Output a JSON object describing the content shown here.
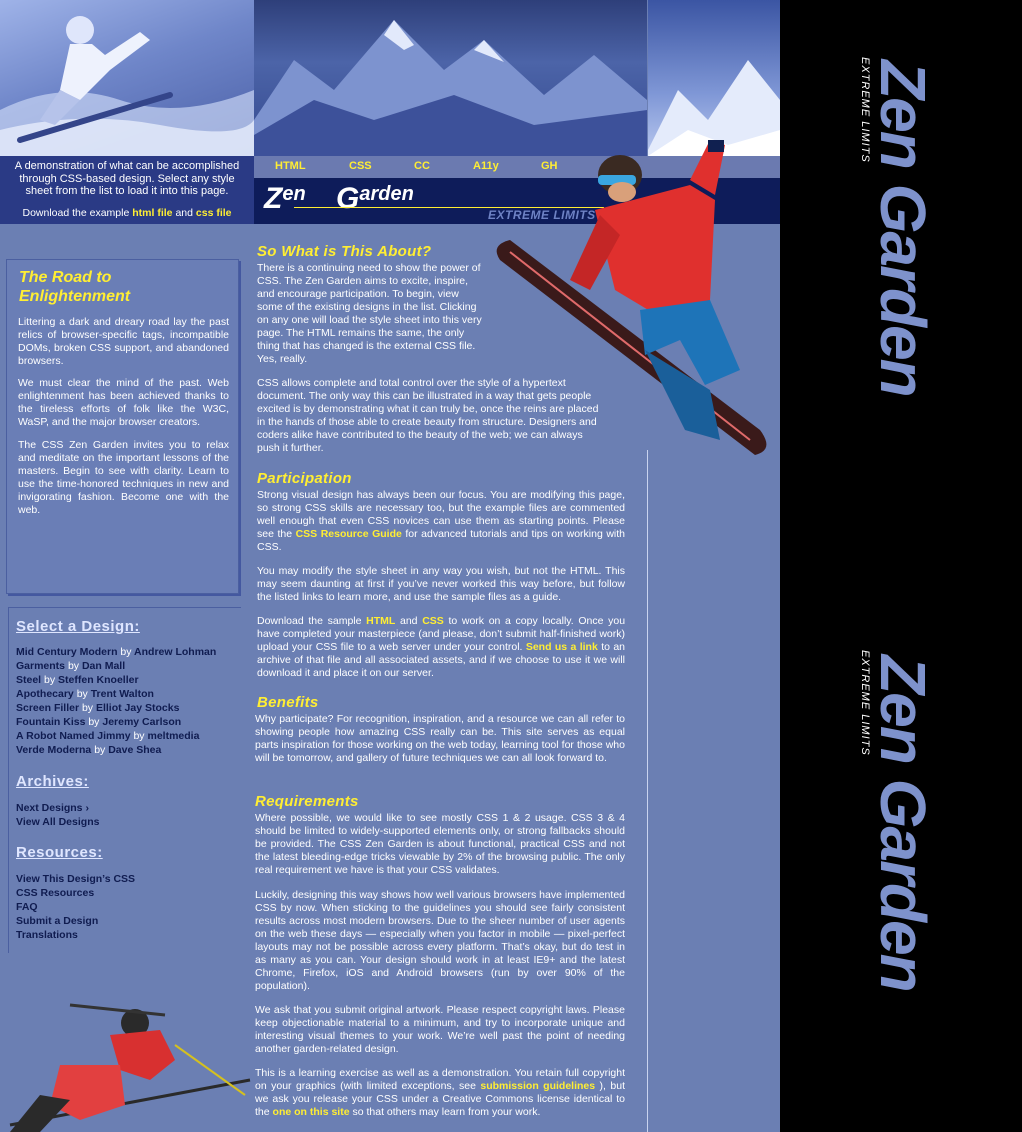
{
  "intro": {
    "text": "A demonstration of what can be accomplished through CSS-based design. Select any style sheet from the list to load it into this page.",
    "download_prefix": "Download the example",
    "html_file": "html file",
    "and": "and",
    "css_file": "css file"
  },
  "nav": {
    "items": [
      "HTML",
      "CSS",
      "CC",
      "A11y",
      "GH"
    ]
  },
  "logo": {
    "zen": "Zen",
    "garden": "Garden",
    "tagline": "EXTREME LIMITS"
  },
  "road": {
    "title": "The Road to Enlightenment",
    "p1": "Littering a dark and dreary road lay the past relics of browser-specific tags, incompatible DOMs, broken CSS support, and abandoned browsers.",
    "p2": "We must clear the mind of the past. Web enlightenment has been achieved thanks to the tireless efforts of folk like the W3C, WaSP, and the major browser creators.",
    "p3": "The CSS Zen Garden invites you to relax and meditate on the important lessons of the masters. Begin to see with clarity. Learn to use the time-honored techniques in new and invigorating fashion. Become one with the web."
  },
  "select": {
    "title": "Select a Design:",
    "by": "by",
    "designs": [
      {
        "name": "Mid Century Modern",
        "author": "Andrew Lohman"
      },
      {
        "name": "Garments",
        "author": "Dan Mall"
      },
      {
        "name": "Steel",
        "author": "Steffen Knoeller"
      },
      {
        "name": "Apothecary",
        "author": "Trent Walton"
      },
      {
        "name": "Screen Filler",
        "author": "Elliot Jay Stocks"
      },
      {
        "name": "Fountain Kiss",
        "author": "Jeremy Carlson"
      },
      {
        "name": "A Robot Named Jimmy",
        "author": "meltmedia"
      },
      {
        "name": "Verde Moderna",
        "author": "Dave Shea"
      }
    ]
  },
  "archives": {
    "title": "Archives:",
    "next": "Next Designs ›",
    "all": "View All Designs"
  },
  "resources": {
    "title": "Resources:",
    "items": [
      "View This Design’s CSS",
      "CSS Resources",
      "FAQ",
      "Submit a Design",
      "Translations"
    ]
  },
  "about": {
    "title": "So What is This About?",
    "p1": "There is a continuing need to show the power of CSS. The Zen Garden aims to excite, inspire, and encourage participation. To begin, view some of the existing designs in the list. Clicking on any one will load the style sheet into this very page. The HTML remains the same, the only thing that has changed is the external CSS file. Yes, really.",
    "p2": "CSS allows complete and total control over the style of a hypertext document. The only way this can be illustrated in a way that gets people excited is by demonstrating what it can truly be, once the reins are placed in the hands of those able to create beauty from structure. Designers and coders alike have contributed to the beauty of the web; we can always push it further."
  },
  "participation": {
    "title": "Participation",
    "p1_a": "Strong visual design has always been our focus. You are modifying this page, so strong CSS skills are necessary too, but the example files are commented well enough that even CSS novices can use them as starting points. Please see the",
    "p1_link": "CSS Resource Guide",
    "p1_b": "for advanced tutorials and tips on working with CSS.",
    "p2": "You may modify the style sheet in any way you wish, but not the HTML. This may seem daunting at first if you’ve never worked this way before, but follow the listed links to learn more, and use the sample files as a guide.",
    "p3_a": "Download the sample",
    "p3_html": "HTML",
    "p3_and": "and",
    "p3_css": "CSS",
    "p3_b": "to work on a copy locally. Once you have completed your masterpiece (and please, don’t submit half-finished work) upload your CSS file to a web server under your control.",
    "p3_link": "Send us a link",
    "p3_c": "to an archive of that file and all associated assets, and if we choose to use it we will download it and place it on our server."
  },
  "benefits": {
    "title": "Benefits",
    "p1": "Why participate? For recognition, inspiration, and a resource we can all refer to showing people how amazing CSS really can be. This site serves as equal parts inspiration for those working on the web today, learning tool for those who will be tomorrow, and gallery of future techniques we can all look forward to."
  },
  "requirements": {
    "title": "Requirements",
    "p1": "Where possible, we would like to see mostly CSS 1 & 2 usage. CSS 3 & 4 should be limited to widely-supported elements only, or strong fallbacks should be provided. The CSS Zen Garden is about functional, practical CSS and not the latest bleeding-edge tricks viewable by 2% of the browsing public. The only real requirement we have is that your CSS validates.",
    "p2": "Luckily, designing this way shows how well various browsers have implemented CSS by now. When sticking to the guidelines you should see fairly consistent results across most modern browsers. Due to the sheer number of user agents on the web these days — especially when you factor in mobile — pixel-perfect layouts may not be possible across every platform. That’s okay, but do test in as many as you can. Your design should work in at least IE9+ and the latest Chrome, Firefox, iOS and Android browsers (run by over 90% of the population).",
    "p3": "We ask that you submit original artwork. Please respect copyright laws. Please keep objectionable material to a minimum, and try to incorporate unique and interesting visual themes to your work. We’re well past the point of needing another garden-related design.",
    "p4_a": "This is a learning exercise as well as a demonstration. You retain full copyright on your graphics (with limited exceptions, see",
    "p4_link1": "submission guidelines",
    "p4_b": "), but we ask you release your CSS under a Creative Commons license identical to the",
    "p4_link2": "one on this site",
    "p4_c": "so that others may learn from your work."
  },
  "side_banner": {
    "title": "Zen Garden",
    "subtitle": "EXTREME LIMITS"
  },
  "colors": {
    "accent_yellow": "#ffee33",
    "page_blue": "#6b7fb3",
    "dark_navy": "#0e1c5a",
    "panel_black": "#000000"
  }
}
